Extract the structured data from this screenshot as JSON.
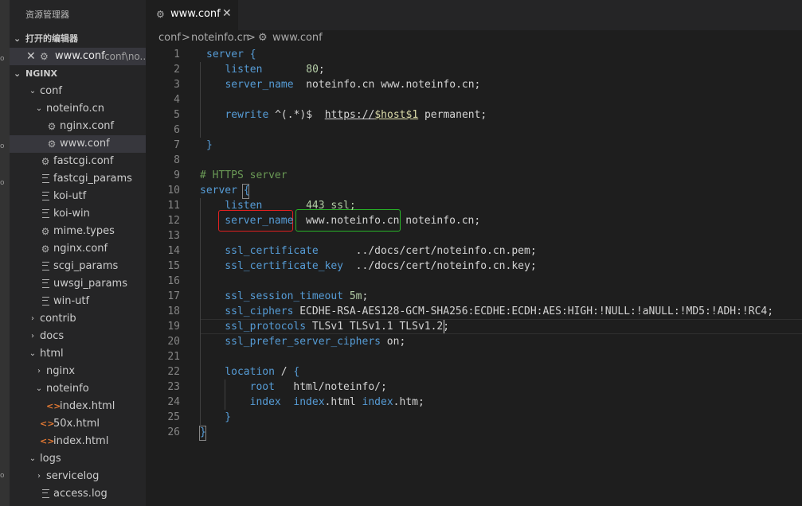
{
  "sidebar": {
    "title": "资源管理器",
    "open_editors": {
      "header": "打开的编辑器",
      "item": {
        "close": "✕",
        "name": "www.conf",
        "path": "conf\\no..."
      }
    },
    "workspace": {
      "header": "NGINX",
      "tree": [
        {
          "label": "conf",
          "type": "folder",
          "open": true,
          "depth": 1
        },
        {
          "label": "noteinfo.cn",
          "type": "folder",
          "open": true,
          "depth": 2
        },
        {
          "label": "nginx.conf",
          "type": "gear",
          "depth": 3
        },
        {
          "label": "www.conf",
          "type": "gear",
          "depth": 3,
          "selected": true
        },
        {
          "label": "fastcgi.conf",
          "type": "gear",
          "depth": 2
        },
        {
          "label": "fastcgi_params",
          "type": "lines",
          "depth": 2
        },
        {
          "label": "koi-utf",
          "type": "lines",
          "depth": 2
        },
        {
          "label": "koi-win",
          "type": "lines",
          "depth": 2
        },
        {
          "label": "mime.types",
          "type": "gear",
          "depth": 2
        },
        {
          "label": "nginx.conf",
          "type": "gear",
          "depth": 2
        },
        {
          "label": "scgi_params",
          "type": "lines",
          "depth": 2
        },
        {
          "label": "uwsgi_params",
          "type": "lines",
          "depth": 2
        },
        {
          "label": "win-utf",
          "type": "lines",
          "depth": 2
        },
        {
          "label": "contrib",
          "type": "folder",
          "open": false,
          "depth": 1
        },
        {
          "label": "docs",
          "type": "folder",
          "open": false,
          "depth": 1
        },
        {
          "label": "html",
          "type": "folder",
          "open": true,
          "depth": 1
        },
        {
          "label": "nginx",
          "type": "folder",
          "open": false,
          "depth": 2
        },
        {
          "label": "noteinfo",
          "type": "folder",
          "open": true,
          "depth": 2
        },
        {
          "label": "index.html",
          "type": "html",
          "depth": 3
        },
        {
          "label": "50x.html",
          "type": "html",
          "depth": 2
        },
        {
          "label": "index.html",
          "type": "html",
          "depth": 2
        },
        {
          "label": "logs",
          "type": "folder",
          "open": true,
          "depth": 1
        },
        {
          "label": "servicelog",
          "type": "folder",
          "open": false,
          "depth": 2
        },
        {
          "label": "access.log",
          "type": "lines",
          "depth": 2
        }
      ]
    }
  },
  "tab": {
    "name": "www.conf",
    "close": "✕"
  },
  "breadcrumb": {
    "parts": [
      "conf",
      ">",
      "noteinfo.cn",
      ">",
      "www.conf"
    ]
  },
  "editor": {
    "lines": [
      [
        {
          "t": "server {",
          "c": "kw"
        }
      ],
      [
        {
          "t": "   listen",
          "c": "kw"
        },
        {
          "t": "       "
        },
        {
          "t": "80",
          "c": "num"
        },
        {
          "t": ";"
        }
      ],
      [
        {
          "t": "   server_name",
          "c": "kw"
        },
        {
          "t": "  noteinfo.cn www.noteinfo.cn;"
        }
      ],
      [],
      [
        {
          "t": "   rewrite",
          "c": "kw"
        },
        {
          "t": " ^(.*)$  "
        },
        {
          "t": "https://",
          "c": "ul"
        },
        {
          "t": "$host",
          "c": "var ul"
        },
        {
          "t": "$1",
          "c": "var ul"
        },
        {
          "t": " permanent;"
        }
      ],
      [],
      [
        {
          "t": "}",
          "c": "kw"
        }
      ],
      [],
      [
        {
          "t": "# HTTPS server",
          "c": "cm"
        }
      ],
      [
        {
          "t": "server ",
          "c": "kw"
        },
        {
          "t": "{",
          "c": "kw"
        }
      ],
      [
        {
          "t": "    listen",
          "c": "kw"
        },
        {
          "t": "       "
        },
        {
          "t": "443",
          "c": "num"
        },
        {
          "t": " ssl;",
          "c": "num"
        }
      ],
      [
        {
          "t": "    server_name",
          "c": "kw"
        },
        {
          "t": "  www.noteinfo.cn noteinfo.cn;"
        }
      ],
      [],
      [
        {
          "t": "    ssl_certificate",
          "c": "kw"
        },
        {
          "t": "      ../docs/cert/noteinfo.cn.pem;"
        }
      ],
      [
        {
          "t": "    ssl_certificate_key",
          "c": "kw"
        },
        {
          "t": "  ../docs/cert/noteinfo.cn.key;"
        }
      ],
      [],
      [
        {
          "t": "    ssl_session_timeout",
          "c": "kw"
        },
        {
          "t": " "
        },
        {
          "t": "5m",
          "c": "num"
        },
        {
          "t": ";"
        }
      ],
      [
        {
          "t": "    ssl_ciphers",
          "c": "kw"
        },
        {
          "t": " ECDHE-RSA-AES128-GCM-SHA256:ECDHE:ECDH:AES:HIGH:!NULL:!aNULL:!MD5:!ADH:!RC4;"
        }
      ],
      [
        {
          "t": "    ssl_protocols",
          "c": "kw"
        },
        {
          "t": " TLSv1 TLSv1.1 TLSv1.2;"
        }
      ],
      [
        {
          "t": "    ssl_prefer_server_ciphers",
          "c": "kw"
        },
        {
          "t": " on;"
        }
      ],
      [],
      [
        {
          "t": "    location",
          "c": "kw"
        },
        {
          "t": " / "
        },
        {
          "t": "{",
          "c": "kw"
        }
      ],
      [
        {
          "t": "        root",
          "c": "kw"
        },
        {
          "t": "   html/noteinfo/;"
        }
      ],
      [
        {
          "t": "        index",
          "c": "kw"
        },
        {
          "t": "  "
        },
        {
          "t": "index",
          "c": "kw"
        },
        {
          "t": ".html "
        },
        {
          "t": "index",
          "c": "kw"
        },
        {
          "t": ".htm;"
        }
      ],
      [
        {
          "t": "    }",
          "c": "kw"
        }
      ],
      [
        {
          "t": "}",
          "c": "kw"
        }
      ]
    ]
  }
}
